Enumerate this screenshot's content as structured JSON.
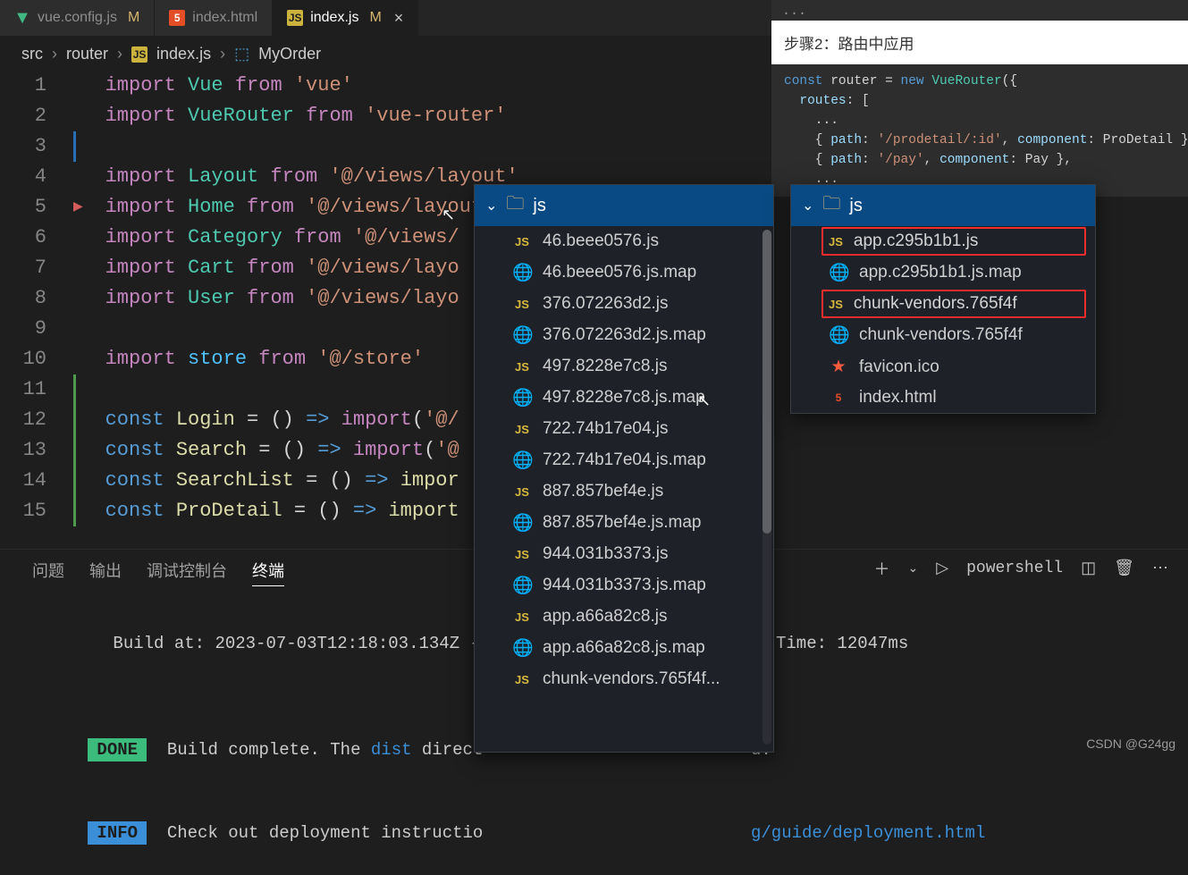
{
  "tabs": [
    {
      "icon": "vue",
      "label": "vue.config.js",
      "modified": "M"
    },
    {
      "icon": "html",
      "label": "index.html",
      "modified": ""
    },
    {
      "icon": "js",
      "label": "index.js",
      "modified": "M",
      "active": true
    }
  ],
  "breadcrumb": {
    "p0": "src",
    "p1": "router",
    "file": "index.js",
    "symbol": "MyOrder"
  },
  "code_lines": [
    {
      "n": "1",
      "html": "<span class='k-purple'>import</span> <span class='k-teal'>Vue</span> <span class='k-purple'>from</span> <span class='k-str'>'vue'</span>"
    },
    {
      "n": "2",
      "html": "<span class='k-purple'>import</span> <span class='k-teal'>VueRouter</span> <span class='k-purple'>from</span> <span class='k-str'>'vue-router'</span>"
    },
    {
      "n": "3",
      "html": "",
      "bar": "blue"
    },
    {
      "n": "4",
      "html": "<span class='k-purple'>import</span> <span class='k-teal'>Layout</span> <span class='k-purple'>from</span> <span class='k-str'>'@/views/layout'</span>"
    },
    {
      "n": "5",
      "html": "<span class='k-purple'>import</span> <span class='k-teal'>Home</span> <span class='k-purple'>from</span> <span class='k-str'>'@/views/layout'</span>",
      "arrow": true
    },
    {
      "n": "6",
      "html": "<span class='k-purple'>import</span> <span class='k-teal'>Category</span> <span class='k-purple'>from</span> <span class='k-str'>'@/views/</span>"
    },
    {
      "n": "7",
      "html": "<span class='k-purple'>import</span> <span class='k-teal'>Cart</span> <span class='k-purple'>from</span> <span class='k-str'>'@/views/layo</span>"
    },
    {
      "n": "8",
      "html": "<span class='k-purple'>import</span> <span class='k-teal'>User</span> <span class='k-purple'>from</span> <span class='k-str'>'@/views/layo</span>"
    },
    {
      "n": "9",
      "html": ""
    },
    {
      "n": "10",
      "html": "<span class='k-purple'>import</span> <span class='k-const'>store</span> <span class='k-purple'>from</span> <span class='k-str'>'@/store'</span>"
    },
    {
      "n": "11",
      "html": "",
      "bar": "green"
    },
    {
      "n": "12",
      "html": "<span class='k-blue'>const</span> <span class='k-func'>Login</span> <span class='k-plain'>=</span> <span class='k-plain'>()</span> <span class='k-blue'>=></span> <span class='k-purple'>import</span><span class='k-plain'>(</span><span class='k-str'>'@/</span>",
      "bar": "green"
    },
    {
      "n": "13",
      "html": "<span class='k-blue'>const</span> <span class='k-func'>Search</span> <span class='k-plain'>=</span> <span class='k-plain'>()</span> <span class='k-blue'>=></span> <span class='k-purple'>import</span><span class='k-plain'>(</span><span class='k-str'>'@</span>",
      "bar": "green"
    },
    {
      "n": "14",
      "html": "<span class='k-blue'>const</span> <span class='k-func'>SearchList</span> <span class='k-plain'>=</span> <span class='k-plain'>()</span> <span class='k-blue'>=></span> <span class='k-func'>impor</span>",
      "bar": "green"
    },
    {
      "n": "15",
      "html": "<span class='k-blue'>const</span> <span class='k-func'>ProDetail</span> <span class='k-plain'>=</span> <span class='k-plain'>()</span> <span class='k-blue'>=></span> <span class='k-func'>import</span>",
      "bar": "green"
    }
  ],
  "panel": {
    "tabs": [
      "问题",
      "输出",
      "调试控制台",
      "终端"
    ],
    "active": 3,
    "shell": "powershell",
    "line1_a": "Build at: ",
    "line1_b": "2023-07-03T12:18:03.134Z - ",
    "line1_c": "Time: 12047ms",
    "done": "DONE",
    "done_text": "Build complete. The ",
    "dist": "dist",
    "done_text2": " direct",
    "done_text2b": "d.",
    "info": "INFO",
    "info_text": "Check out deployment instructio",
    "info_link": "g/guide/deployment.html"
  },
  "doc": {
    "dots": "...",
    "step": "步骤2：路由中应用",
    "code": "const router = new VueRouter({\n  routes: [\n    ...\n    { path: '/prodetail/:id', component: ProDetail },\n    { path: '/pay', component: Pay },\n    ..."
  },
  "popup1": {
    "title": "js",
    "items": [
      {
        "t": "js",
        "n": "46.beee0576.js"
      },
      {
        "t": "map",
        "n": "46.beee0576.js.map"
      },
      {
        "t": "js",
        "n": "376.072263d2.js"
      },
      {
        "t": "map",
        "n": "376.072263d2.js.map"
      },
      {
        "t": "js",
        "n": "497.8228e7c8.js"
      },
      {
        "t": "map",
        "n": "497.8228e7c8.js.map"
      },
      {
        "t": "js",
        "n": "722.74b17e04.js"
      },
      {
        "t": "map",
        "n": "722.74b17e04.js.map"
      },
      {
        "t": "js",
        "n": "887.857bef4e.js"
      },
      {
        "t": "map",
        "n": "887.857bef4e.js.map"
      },
      {
        "t": "js",
        "n": "944.031b3373.js"
      },
      {
        "t": "map",
        "n": "944.031b3373.js.map"
      },
      {
        "t": "js",
        "n": "app.a66a82c8.js"
      },
      {
        "t": "map",
        "n": "app.a66a82c8.js.map"
      },
      {
        "t": "js",
        "n": "chunk-vendors.765f4f..."
      }
    ]
  },
  "popup2": {
    "title": "js",
    "items": [
      {
        "t": "js",
        "n": "app.c295b1b1.js",
        "hl": true
      },
      {
        "t": "map",
        "n": "app.c295b1b1.js.map"
      },
      {
        "t": "js",
        "n": "chunk-vendors.765f4f",
        "hl": true
      },
      {
        "t": "map",
        "n": "chunk-vendors.765f4f"
      },
      {
        "t": "fav",
        "n": "favicon.ico"
      },
      {
        "t": "html",
        "n": "index.html"
      }
    ]
  },
  "watermark": "CSDN @G24gg"
}
